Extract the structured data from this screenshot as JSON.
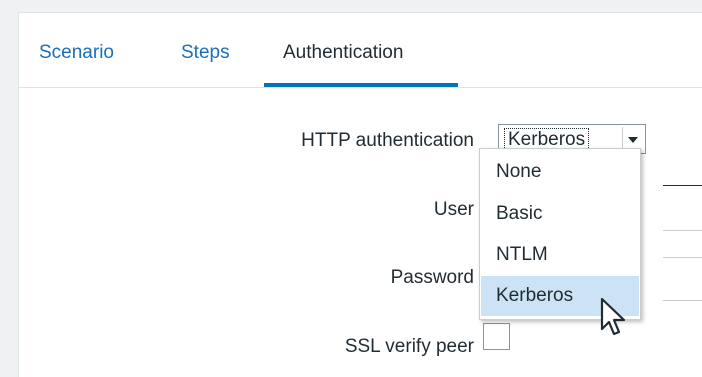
{
  "tabs": [
    {
      "label": "Scenario"
    },
    {
      "label": "Steps"
    },
    {
      "label": "Authentication"
    }
  ],
  "form": {
    "http_auth_label": "HTTP authentication",
    "user_label": "User",
    "password_label": "Password",
    "ssl_label": "SSL verify peer",
    "http_auth_value": "Kerberos",
    "ssl_checked": false
  },
  "dropdown": {
    "options": [
      {
        "label": "None"
      },
      {
        "label": "Basic"
      },
      {
        "label": "NTLM"
      },
      {
        "label": "Kerberos"
      }
    ],
    "highlighted": "Kerberos"
  },
  "colors": {
    "tab_link": "#1a6fb8",
    "tab_active_underline": "#0275b8",
    "highlight": "#cce3f5"
  }
}
